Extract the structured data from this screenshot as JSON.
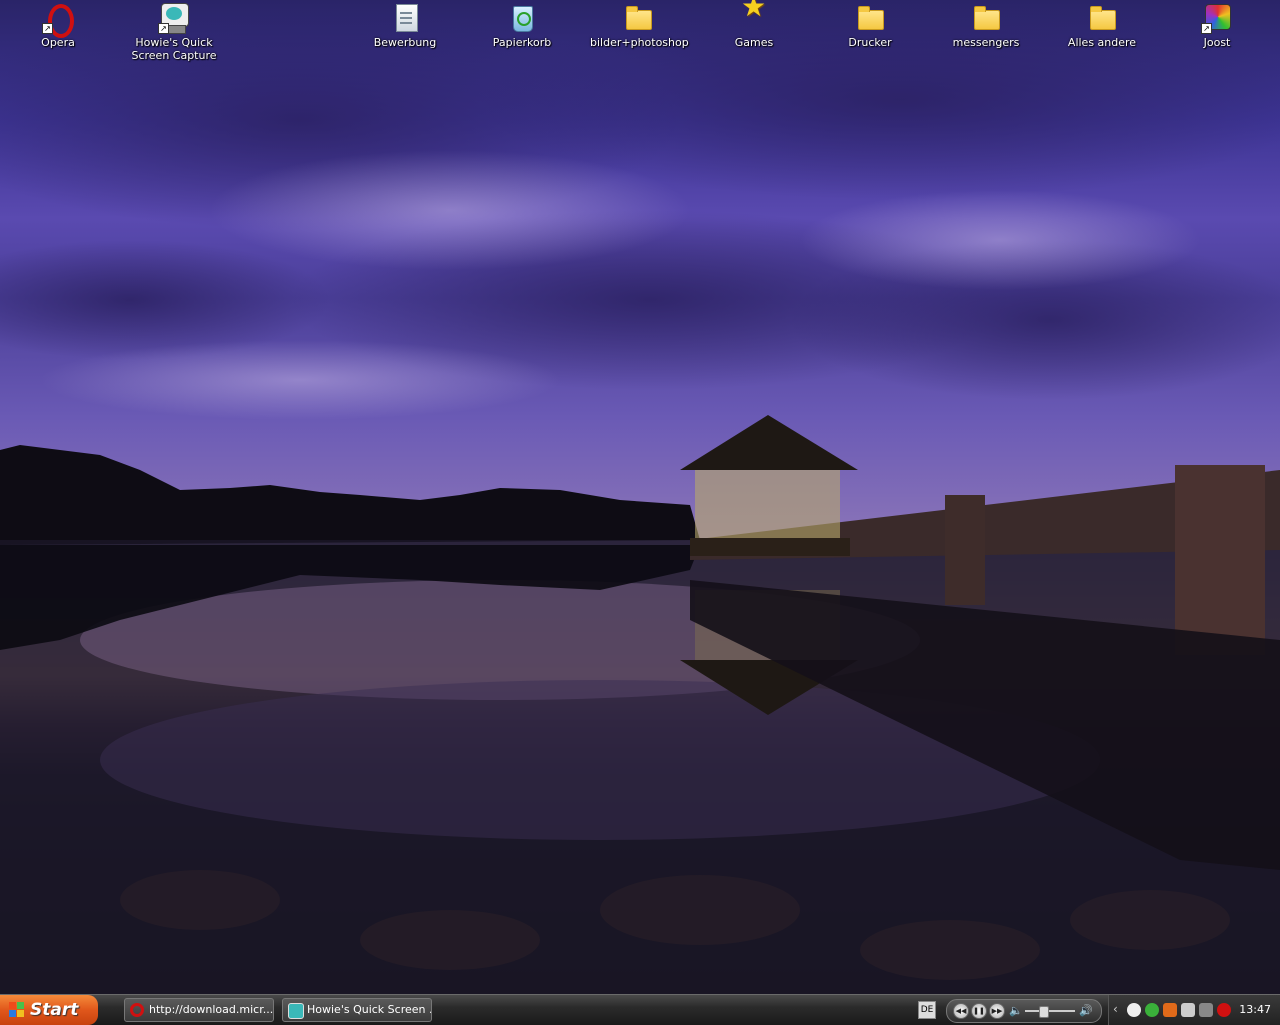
{
  "desktop": {
    "icons": [
      {
        "label": "Opera",
        "icon": "opera-icon"
      },
      {
        "label": "Howie's Quick Screen Capture",
        "icon": "screen-capture-icon"
      },
      {
        "label": "Bewerbung",
        "icon": "document-icon"
      },
      {
        "label": "Papierkorb",
        "icon": "recycle-bin-icon"
      },
      {
        "label": "bilder+photoshop",
        "icon": "folder-icon"
      },
      {
        "label": "Games",
        "icon": "star-icon"
      },
      {
        "label": "Drucker",
        "icon": "folder-icon"
      },
      {
        "label": "messengers",
        "icon": "folder-icon"
      },
      {
        "label": "Alles andere",
        "icon": "folder-icon"
      },
      {
        "label": "Joost",
        "icon": "joost-icon"
      }
    ]
  },
  "taskbar": {
    "start_label": "Start",
    "tasks": [
      {
        "label": "http://download.micr...",
        "icon": "opera-icon"
      },
      {
        "label": "Howie's Quick Screen ...",
        "icon": "screen-capture-icon"
      }
    ],
    "language": "DE",
    "clock": "13:47"
  },
  "colors": {
    "start": "#e0571b",
    "taskbar": "#2b2b2b",
    "sky": "#5a4ab0"
  }
}
